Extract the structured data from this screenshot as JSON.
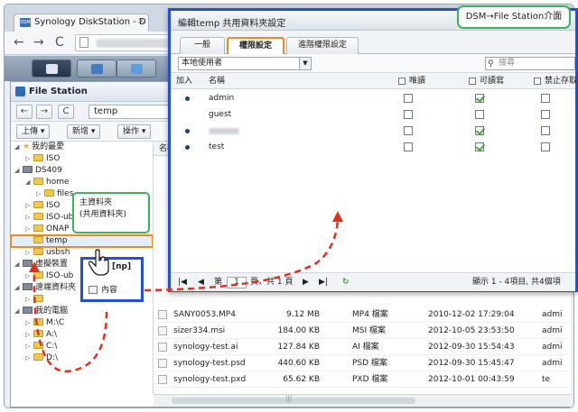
{
  "browser": {
    "tab_title": "Synology DiskStation - D",
    "tab_close": "×",
    "logo_text": "DSM",
    "back": "←",
    "forward": "→",
    "reload": "C"
  },
  "file_station": {
    "title": "File Station",
    "path_value": "temp",
    "nav": {
      "back": "←",
      "forward": "→",
      "refresh": "C"
    },
    "toolbar": [
      "上傳 ▾",
      "新增 ▾",
      "操作 ▾"
    ],
    "tree": [
      {
        "indent": 0,
        "tri": "◢",
        "icon": "star",
        "label": "我的最愛"
      },
      {
        "indent": 1,
        "tri": "▷",
        "icon": "folder",
        "label": "ISO"
      },
      {
        "indent": 0,
        "tri": "◢",
        "icon": "nas",
        "label": "DS409"
      },
      {
        "indent": 1,
        "tri": "◢",
        "icon": "folder",
        "label": "home"
      },
      {
        "indent": 2,
        "tri": "▷",
        "icon": "folder",
        "label": "files"
      },
      {
        "indent": 1,
        "tri": "▷",
        "icon": "folder",
        "label": "ISO"
      },
      {
        "indent": 1,
        "tri": "▷",
        "icon": "folder",
        "label": "ISO-ub"
      },
      {
        "indent": 1,
        "tri": "▷",
        "icon": "folder",
        "label": "ONAP"
      },
      {
        "indent": 1,
        "tri": "",
        "icon": "folder",
        "label": "temp"
      },
      {
        "indent": 1,
        "tri": "▷",
        "icon": "folder",
        "label": "usbsh"
      },
      {
        "indent": 0,
        "tri": "◢",
        "icon": "nas",
        "label": "虛擬裝置"
      },
      {
        "indent": 1,
        "tri": "▷",
        "icon": "folder",
        "label": "ISO-ub"
      },
      {
        "indent": 0,
        "tri": "◢",
        "icon": "nas",
        "label": "遠端資料夾"
      },
      {
        "indent": 1,
        "tri": "▷",
        "icon": "folder",
        "label": ""
      },
      {
        "indent": 0,
        "tri": "◢",
        "icon": "nas",
        "label": "我的電腦"
      },
      {
        "indent": 1,
        "tri": "▷",
        "icon": "folder",
        "label": "M:\\C"
      },
      {
        "indent": 1,
        "tri": "▷",
        "icon": "folder",
        "label": "A:\\"
      },
      {
        "indent": 1,
        "tri": "▷",
        "icon": "folder",
        "label": "C:\\"
      },
      {
        "indent": 1,
        "tri": "▷",
        "icon": "folder",
        "label": "D:\\"
      }
    ],
    "list_header": "名稱",
    "files": [
      {
        "name": "SANY0053.MP4",
        "size": "9.12 MB",
        "type": "MP4 檔案",
        "date": "2010-12-02 17:29:04",
        "owner": "admi"
      },
      {
        "name": "sizer334.msi",
        "size": "184.00 KB",
        "type": "MSI 檔案",
        "date": "2012-10-05 23:53:50",
        "owner": "admi"
      },
      {
        "name": "synology-test.ai",
        "size": "127.84 KB",
        "type": "AI 檔案",
        "date": "2012-09-30 15:54:43",
        "owner": "admi"
      },
      {
        "name": "synology-test.psd",
        "size": "440.60 KB",
        "type": "PSD 檔案",
        "date": "2012-09-30 15:45:47",
        "owner": "admi"
      },
      {
        "name": "synology-test.pxd",
        "size": "65.62 KB",
        "type": "PXD 檔案",
        "date": "2012-10-01 00:43:59",
        "owner": "te"
      }
    ],
    "scroll_marker": "|||"
  },
  "dialog": {
    "title": "編輯temp 共用資料夾設定",
    "tabs": [
      "一般",
      "權限設定",
      "進階權限設定"
    ],
    "active_tab": 1,
    "user_select": "本地使用者",
    "search_placeholder": "搜尋",
    "col_add": "加入",
    "col_name": "名稱",
    "col_ro": "唯讀",
    "col_rw": "可讀寫",
    "col_deny": "禁止存取",
    "users": [
      {
        "dot": true,
        "name": "admin",
        "ro": false,
        "rw": true,
        "deny": false
      },
      {
        "dot": false,
        "name": "guest",
        "ro": false,
        "rw": false,
        "deny": false
      },
      {
        "dot": true,
        "name": "",
        "ro": false,
        "rw": true,
        "deny": false
      },
      {
        "dot": true,
        "name": "test",
        "ro": false,
        "rw": true,
        "deny": false
      }
    ],
    "pager_page_label": "第",
    "pager_page": "1",
    "pager_of": "頁，共 1 頁",
    "pager_status": "顯示 1 - 4項目, 共4個項"
  },
  "callouts": {
    "top_right": "DSM→File Station介面",
    "shared_folder": "主資料夾\n(共用資料夾)",
    "context_partial": "[np]",
    "context_item": "內容"
  },
  "colors": {
    "highlight_blue": "#1f4fe0",
    "highlight_orange": "#f08a1c",
    "callout_green": "#36b65a",
    "arrow_red": "#e0301e"
  }
}
